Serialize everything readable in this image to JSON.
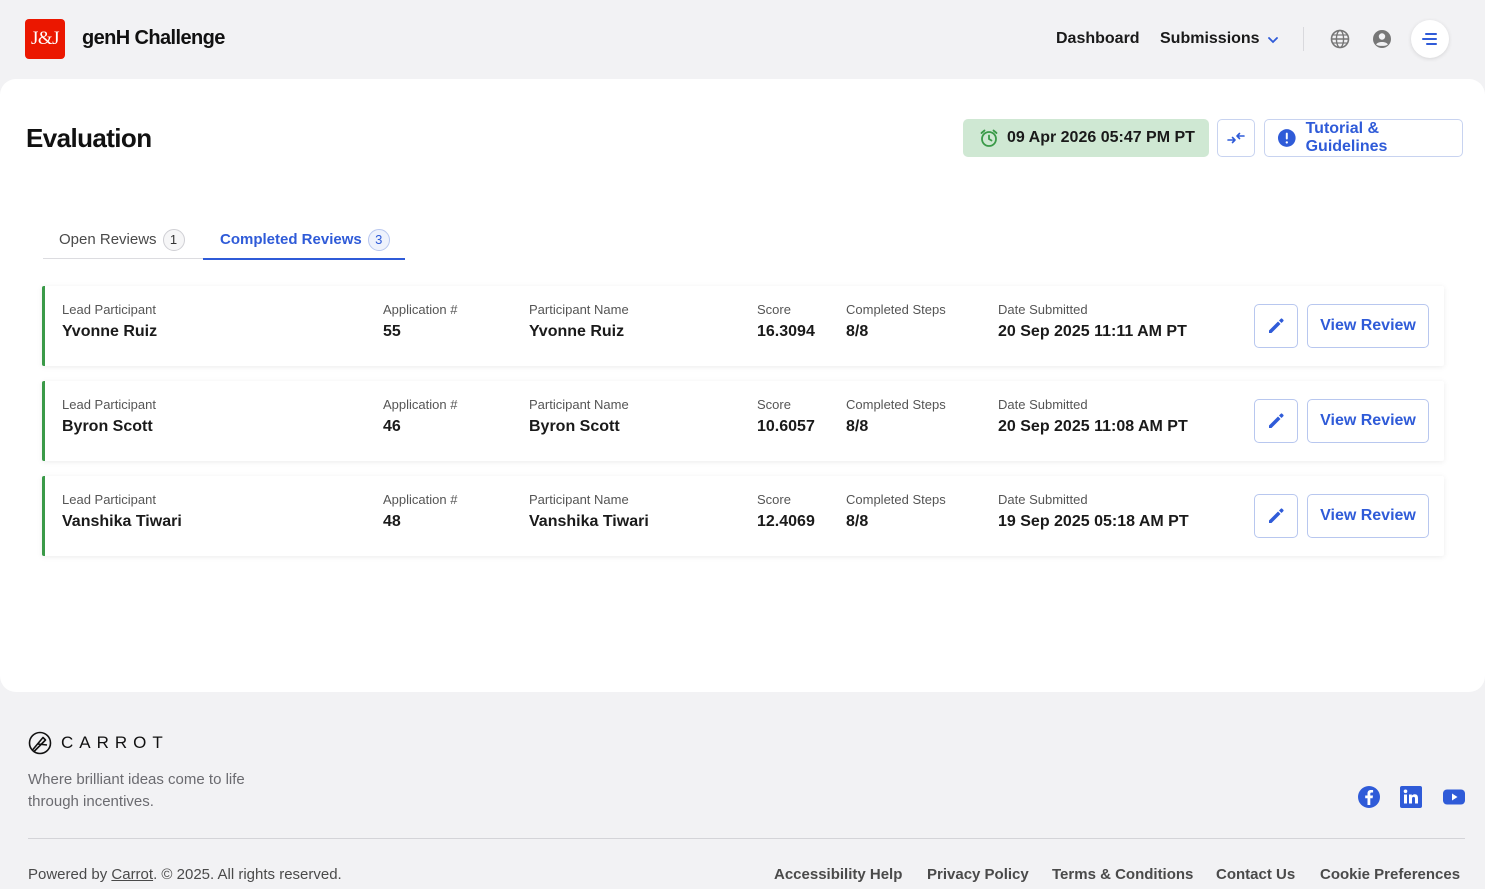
{
  "header": {
    "logo_text": "J&J",
    "app_title": "genH Challenge",
    "nav": {
      "dashboard": "Dashboard",
      "submissions": "Submissions"
    }
  },
  "page": {
    "title": "Evaluation",
    "deadline": "09 Apr 2026 05:47 PM PT",
    "tutorial_label": "Tutorial & Guidelines"
  },
  "tabs": [
    {
      "label": "Open Reviews",
      "count": "1"
    },
    {
      "label": "Completed Reviews",
      "count": "3"
    }
  ],
  "columns": {
    "lead": "Lead Participant",
    "application": "Application #",
    "participant": "Participant Name",
    "score": "Score",
    "steps": "Completed Steps",
    "date": "Date Submitted"
  },
  "reviews": [
    {
      "lead": "Yvonne Ruiz",
      "application": "55",
      "participant": "Yvonne Ruiz",
      "score": "16.3094",
      "steps": "8/8",
      "date": "20 Sep 2025 11:11 AM PT"
    },
    {
      "lead": "Byron Scott",
      "application": "46",
      "participant": "Byron Scott",
      "score": "10.6057",
      "steps": "8/8",
      "date": "20 Sep 2025 11:08 AM PT"
    },
    {
      "lead": "Vanshika Tiwari",
      "application": "48",
      "participant": "Vanshika Tiwari",
      "score": "12.4069",
      "steps": "8/8",
      "date": "19 Sep 2025 05:18 AM PT"
    }
  ],
  "actions": {
    "view_review": "View Review"
  },
  "footer": {
    "brand": "CARROT",
    "tagline": "Where brilliant ideas come to life through incentives.",
    "powered_prefix": "Powered by ",
    "powered_link": "Carrot",
    "powered_suffix": ". © 2025. All rights reserved.",
    "links": [
      "Accessibility Help",
      "Privacy Policy",
      "Terms & Conditions",
      "Contact Us",
      "Cookie Preferences"
    ]
  },
  "colors": {
    "brand_red": "#eb1700",
    "accent_blue": "#2f5bd8",
    "status_green": "#3a9a48",
    "deadline_bg": "#cfe8d3"
  }
}
